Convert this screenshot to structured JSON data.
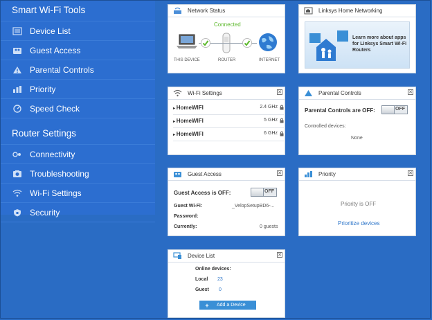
{
  "sidebar": {
    "smart_tools_title": "Smart Wi-Fi Tools",
    "smart_items": [
      {
        "label": "Device List",
        "icon": "device-list-icon"
      },
      {
        "label": "Guest Access",
        "icon": "guest-access-icon"
      },
      {
        "label": "Parental Controls",
        "icon": "parental-controls-icon"
      },
      {
        "label": "Priority",
        "icon": "priority-icon"
      },
      {
        "label": "Speed Check",
        "icon": "speed-check-icon"
      }
    ],
    "router_settings_title": "Router Settings",
    "router_items": [
      {
        "label": "Connectivity",
        "icon": "connectivity-icon"
      },
      {
        "label": "Troubleshooting",
        "icon": "troubleshooting-icon"
      },
      {
        "label": "Wi-Fi Settings",
        "icon": "wifi-icon"
      },
      {
        "label": "Security",
        "icon": "security-icon"
      }
    ]
  },
  "network_status": {
    "title": "Network Status",
    "connected": "Connected",
    "this_device": "THIS DEVICE",
    "router": "ROUTER",
    "internet": "INTERNET"
  },
  "linksys_home": {
    "title": "Linksys Home Networking",
    "promo": "Learn more about apps for Linksys Smart Wi-Fi Routers"
  },
  "wifi_settings": {
    "title": "Wi-Fi Settings",
    "networks": [
      {
        "name": "HomeWIFI",
        "band": "2.4 GHz"
      },
      {
        "name": "HomeWIFI",
        "band": "5 GHz"
      },
      {
        "name": "HomeWIFI",
        "band": "6 GHz"
      }
    ]
  },
  "parental_controls": {
    "title": "Parental Controls",
    "status": "Parental Controls are OFF:",
    "toggle": "OFF",
    "controlled_label": "Controlled devices:",
    "controlled_value": "None"
  },
  "guest_access": {
    "title": "Guest Access",
    "status": "Guest Access is OFF:",
    "toggle": "OFF",
    "wifi_label": "Guest Wi-Fi:",
    "wifi_value": "_VelopSetupBD6-...",
    "password_label": "Password:",
    "currently_label": "Currently:",
    "currently_value": "0 guests"
  },
  "priority": {
    "title": "Priority",
    "status": "Priority is OFF",
    "link": "Prioritize devices"
  },
  "device_list": {
    "title": "Device List",
    "online_label": "Online devices:",
    "local_label": "Local",
    "local_count": "23",
    "guest_label": "Guest",
    "guest_count": "0",
    "add_button": "Add a Device"
  },
  "colors": {
    "background": "#2a6cc4",
    "sidebar": "#2c6ed0",
    "link": "#2c75c9",
    "check": "#5cb82b"
  }
}
